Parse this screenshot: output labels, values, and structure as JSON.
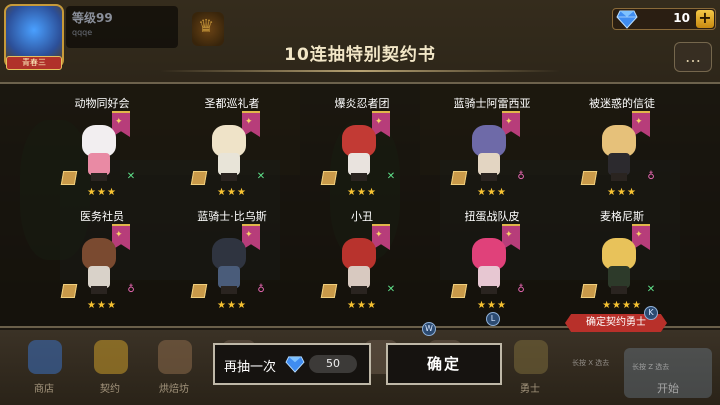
{
  "hud": {
    "level_label": "等级99",
    "player_name": "qqqe",
    "avatar_badge": "青春三",
    "gem_count": "10",
    "plus_label": "+",
    "chat_icon": "chat-bubble-icon",
    "crown_icon": "crown-icon"
  },
  "title": "10连抽特别契约书",
  "cards": [
    {
      "name": "动物同好会",
      "stars": "★★★",
      "element": "leaf",
      "head": "#f2eef0",
      "body": "#e98aa4"
    },
    {
      "name": "圣都巡礼者",
      "stars": "★★★",
      "element": "leaf",
      "head": "#efe3c8",
      "body": "#e8e4d8"
    },
    {
      "name": "爆炎忍者团",
      "stars": "★★★",
      "element": "leaf",
      "head": "#c23a34",
      "body": "#e9e3de"
    },
    {
      "name": "蓝骑士阿雷西亚",
      "stars": "★★★",
      "element": "pink",
      "head": "#6e6aa8",
      "body": "#e3d5c2"
    },
    {
      "name": "被迷惑的信徒",
      "stars": "★★★",
      "element": "pink",
      "head": "#e6c17a",
      "body": "#2c2a2e"
    },
    {
      "name": "医务社员",
      "stars": "★★★",
      "element": "pink",
      "head": "#7a4a30",
      "body": "#d9d2c9"
    },
    {
      "name": "蓝骑士·比乌斯",
      "stars": "★★★",
      "element": "pink",
      "head": "#2f3440",
      "body": "#4a5c7a"
    },
    {
      "name": "小丑",
      "stars": "★★★",
      "element": "leaf",
      "head": "#b8332d",
      "body": "#d8c9c0"
    },
    {
      "name": "扭蛋战队皮",
      "stars": "★★★",
      "element": "pink",
      "head": "#e0417a",
      "body": "#e7c7d2"
    },
    {
      "name": "麦格尼斯",
      "stars": "★★★★",
      "element": "leaf",
      "head": "#e8c25a",
      "body": "#2d3a2a"
    }
  ],
  "buttons": {
    "draw_again_label": "再抽一次",
    "draw_again_cost": "50",
    "confirm_label": "确定"
  },
  "ribbon": "确定契约勇士",
  "nav": [
    {
      "label": "商店",
      "icon": "shop-icon"
    },
    {
      "label": "契约",
      "icon": "contract-icon"
    },
    {
      "label": "烘焙坊",
      "icon": "bakery-icon"
    },
    {
      "label": "",
      "icon": "item-icon"
    },
    {
      "label": "",
      "icon": "item-icon"
    },
    {
      "label": "",
      "icon": "item-icon"
    },
    {
      "label": "勇士",
      "icon": "hero-icon"
    }
  ],
  "start_label": "开始",
  "hints": [
    "长按 X 选去",
    "长按 Z 选去"
  ],
  "small_tags": [
    "W",
    "L",
    "K"
  ],
  "colors": {
    "accent_gold": "#f6c232",
    "ribbon_red": "#b8302a",
    "banner_pink": "#b73d7a"
  }
}
